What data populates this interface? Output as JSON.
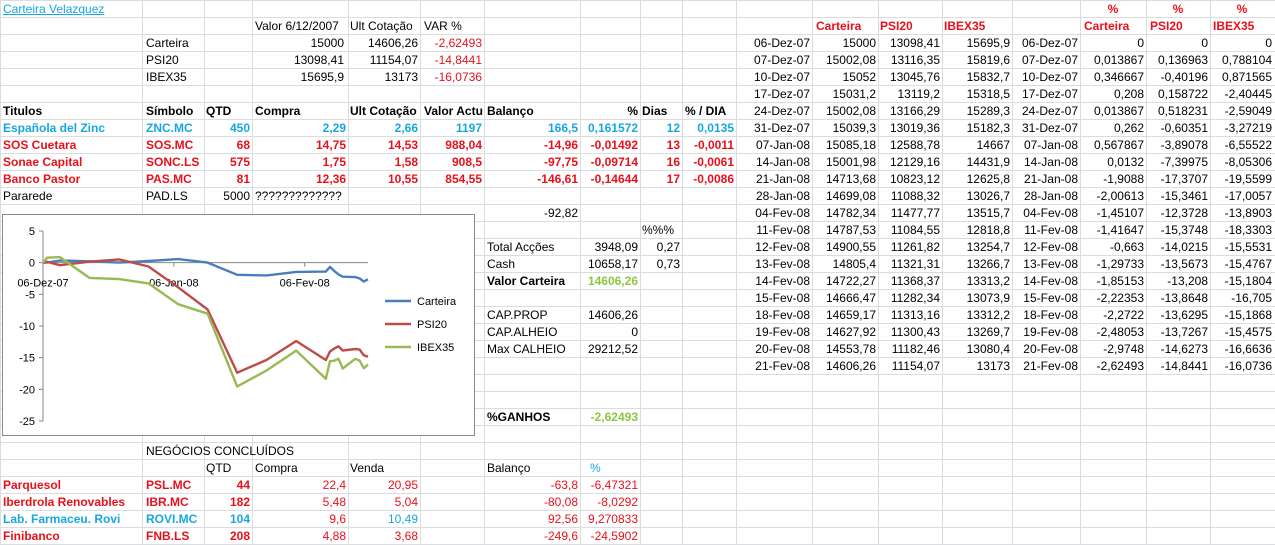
{
  "title": "Carteira Velazquez",
  "summary": {
    "headers": [
      "Valor 6/12/2007",
      "Ult Cotação",
      "VAR %"
    ],
    "rows": [
      {
        "label": "Carteira",
        "v1": "15000",
        "v2": "14606,26",
        "var": "-2,62493"
      },
      {
        "label": "PSI20",
        "v1": "13098,41",
        "v2": "11154,07",
        "var": "-14,8441"
      },
      {
        "label": "IBEX35",
        "v1": "15695,9",
        "v2": "13173",
        "var": "-16,0736"
      }
    ]
  },
  "holdings": {
    "headers": [
      "Titulos",
      "Símbolo",
      "QTD",
      "Compra",
      "Ult Cotação",
      "Valor Actu",
      "Balanço",
      "%",
      "Dias",
      "% / DIA"
    ],
    "rows": [
      {
        "name": "Española del Zinc",
        "sym": "ZNC.MC",
        "qtd": "450",
        "compra": "2,29",
        "ult": "2,66",
        "valor": "1197",
        "bal": "166,5",
        "pct": "0,161572",
        "dias": "12",
        "pdia": "0,0135",
        "color": "blue"
      },
      {
        "name": "SOS Cuetara",
        "sym": "SOS.MC",
        "qtd": "68",
        "compra": "14,75",
        "ult": "14,53",
        "valor": "988,04",
        "bal": "-14,96",
        "pct": "-0,01492",
        "dias": "13",
        "pdia": "-0,0011",
        "color": "red"
      },
      {
        "name": "Sonae Capital",
        "sym": "SONC.LS",
        "qtd": "575",
        "compra": "1,75",
        "ult": "1,58",
        "valor": "908,5",
        "bal": "-97,75",
        "pct": "-0,09714",
        "dias": "16",
        "pdia": "-0,0061",
        "color": "red"
      },
      {
        "name": "Banco Pastor",
        "sym": "PAS.MC",
        "qtd": "81",
        "compra": "12,36",
        "ult": "10,55",
        "valor": "854,55",
        "bal": "-146,61",
        "pct": "-0,14644",
        "dias": "17",
        "pdia": "-0,0086",
        "color": "red"
      },
      {
        "name": "Pararede",
        "sym": "PAD.LS",
        "qtd": "5000",
        "compra": "?????????????",
        "ult": "",
        "valor": "",
        "bal": "",
        "pct": "",
        "dias": "",
        "pdia": "",
        "color": "plain"
      }
    ],
    "total_balance": "-92,82"
  },
  "stats": {
    "pct_header": "%%%",
    "rows": [
      {
        "label": "Total Acções",
        "value": "3948,09",
        "pct": "0,27"
      },
      {
        "label": "Cash",
        "value": "10658,17",
        "pct": "0,73"
      }
    ],
    "valor_carteira_label": "Valor Carteira",
    "valor_carteira": "14606,26",
    "cap_rows": [
      {
        "label": "CAP.PROP",
        "value": "14606,26"
      },
      {
        "label": "CAP.ALHEIO",
        "value": "0"
      },
      {
        "label": "Max CALHEIO",
        "value": "29212,52"
      }
    ],
    "ganhos_label": "%GANHOS",
    "ganhos": "-2,62493"
  },
  "closed": {
    "title": "NEGÓCIOS CONCLUÍDOS",
    "headers": {
      "qtd": "QTD",
      "compra": "Compra",
      "venda": "Venda",
      "bal": "Balanço",
      "pct": "%"
    },
    "rows": [
      {
        "name": "Parquesol",
        "sym": "PSL.MC",
        "qtd": "44",
        "compra": "22,4",
        "venda": "20,95",
        "bal": "-63,8",
        "pct": "-6,47321",
        "color": "red"
      },
      {
        "name": "Iberdrola Renovables",
        "sym": "IBR.MC",
        "qtd": "182",
        "compra": "5,48",
        "venda": "5,04",
        "bal": "-80,08",
        "pct": "-8,0292",
        "color": "red"
      },
      {
        "name": "Lab. Farmaceu. Rovi",
        "sym": "ROVI.MC",
        "qtd": "104",
        "compra": "9,6",
        "venda": "10,49",
        "bal": "92,56",
        "pct": "9,270833",
        "color": "blue"
      },
      {
        "name": "Finibanco",
        "sym": "FNB.LS",
        "qtd": "208",
        "compra": "4,88",
        "venda": "3,68",
        "bal": "-249,6",
        "pct": "-24,5902",
        "color": "red"
      }
    ]
  },
  "history": {
    "headers": [
      "Carteira",
      "PSI20",
      "IBEX35"
    ],
    "rows": [
      [
        "06-Dez-07",
        "15000",
        "13098,41",
        "15695,9"
      ],
      [
        "07-Dez-07",
        "15002,08",
        "13116,35",
        "15819,6"
      ],
      [
        "10-Dez-07",
        "15052",
        "13045,76",
        "15832,7"
      ],
      [
        "17-Dez-07",
        "15031,2",
        "13119,2",
        "15318,5"
      ],
      [
        "24-Dez-07",
        "15002,08",
        "13166,29",
        "15289,3"
      ],
      [
        "31-Dez-07",
        "15039,3",
        "13019,36",
        "15182,3"
      ],
      [
        "07-Jan-08",
        "15085,18",
        "12588,78",
        "14667"
      ],
      [
        "14-Jan-08",
        "15001,98",
        "12129,16",
        "14431,9"
      ],
      [
        "21-Jan-08",
        "14713,68",
        "10823,12",
        "12625,8"
      ],
      [
        "28-Jan-08",
        "14699,08",
        "11088,32",
        "13026,7"
      ],
      [
        "04-Fev-08",
        "14782,34",
        "11477,77",
        "13515,7"
      ],
      [
        "11-Fev-08",
        "14787,53",
        "11084,55",
        "12818,8"
      ],
      [
        "12-Fev-08",
        "14900,55",
        "11261,82",
        "13254,7"
      ],
      [
        "13-Fev-08",
        "14805,4",
        "11321,31",
        "13266,7"
      ],
      [
        "14-Fev-08",
        "14722,27",
        "11368,37",
        "13313,2"
      ],
      [
        "15-Fev-08",
        "14666,47",
        "11282,34",
        "13073,9"
      ],
      [
        "18-Fev-08",
        "14659,17",
        "11313,16",
        "13312,2"
      ],
      [
        "19-Fev-08",
        "14627,92",
        "11300,43",
        "13269,7"
      ],
      [
        "20-Fev-08",
        "14553,78",
        "11182,46",
        "13080,4"
      ],
      [
        "21-Fev-08",
        "14606,26",
        "11154,07",
        "13173"
      ]
    ]
  },
  "pct_history": {
    "headers": [
      "Carteira",
      "PSI20",
      "IBEX35"
    ],
    "pct_symbol": "%",
    "rows": [
      [
        "06-Dez-07",
        "0",
        "0",
        "0"
      ],
      [
        "07-Dez-07",
        "0,013867",
        "0,136963",
        "0,788104"
      ],
      [
        "10-Dez-07",
        "0,346667",
        "-0,40196",
        "0,871565"
      ],
      [
        "17-Dez-07",
        "0,208",
        "0,158722",
        "-2,40445"
      ],
      [
        "24-Dez-07",
        "0,013867",
        "0,518231",
        "-2,59049"
      ],
      [
        "31-Dez-07",
        "0,262",
        "-0,60351",
        "-3,27219"
      ],
      [
        "07-Jan-08",
        "0,567867",
        "-3,89078",
        "-6,55522"
      ],
      [
        "14-Jan-08",
        "0,0132",
        "-7,39975",
        "-8,05306"
      ],
      [
        "21-Jan-08",
        "-1,9088",
        "-17,3707",
        "-19,5599"
      ],
      [
        "28-Jan-08",
        "-2,00613",
        "-15,3461",
        "-17,0057"
      ],
      [
        "04-Fev-08",
        "-1,45107",
        "-12,3728",
        "-13,8903"
      ],
      [
        "11-Fev-08",
        "-1,41647",
        "-15,3748",
        "-18,3303"
      ],
      [
        "12-Fev-08",
        "-0,663",
        "-14,0215",
        "-15,5531"
      ],
      [
        "13-Fev-08",
        "-1,29733",
        "-13,5673",
        "-15,4767"
      ],
      [
        "14-Fev-08",
        "-1,85153",
        "-13,208",
        "-15,1804"
      ],
      [
        "15-Fev-08",
        "-2,22353",
        "-13,8648",
        "-16,705"
      ],
      [
        "18-Fev-08",
        "-2,2722",
        "-13,6295",
        "-15,1868"
      ],
      [
        "19-Fev-08",
        "-2,48053",
        "-13,7267",
        "-15,4575"
      ],
      [
        "20-Fev-08",
        "-2,9748",
        "-14,6273",
        "-16,6636"
      ],
      [
        "21-Fev-08",
        "-2,62493",
        "-14,8441",
        "-16,0736"
      ]
    ]
  },
  "chart_data": {
    "type": "line",
    "x": [
      "06-Dez-07",
      "07-Dez-07",
      "10-Dez-07",
      "17-Dez-07",
      "24-Dez-07",
      "31-Dez-07",
      "07-Jan-08",
      "14-Jan-08",
      "21-Jan-08",
      "28-Jan-08",
      "04-Fev-08",
      "11-Fev-08",
      "12-Fev-08",
      "13-Fev-08",
      "14-Fev-08",
      "15-Fev-08",
      "18-Fev-08",
      "19-Fev-08",
      "20-Fev-08",
      "21-Fev-08"
    ],
    "x_ticks": [
      "06-Dez-07",
      "06-Jan-08",
      "06-Fev-08"
    ],
    "ylim": [
      -25,
      5
    ],
    "y_ticks": [
      "5",
      "0",
      "-5",
      "-10",
      "-15",
      "-20",
      "-25"
    ],
    "series": [
      {
        "name": "Carteira",
        "color": "#4a7ebb",
        "values": [
          0,
          0.013867,
          0.346667,
          0.208,
          0.013867,
          0.262,
          0.567867,
          0.0132,
          -1.9088,
          -2.00613,
          -1.45107,
          -1.41647,
          -0.663,
          -1.29733,
          -1.85153,
          -2.22353,
          -2.2722,
          -2.48053,
          -2.9748,
          -2.62493
        ]
      },
      {
        "name": "PSI20",
        "color": "#be4b48",
        "values": [
          0,
          0.136963,
          -0.40196,
          0.158722,
          0.518231,
          -0.60351,
          -3.89078,
          -7.39975,
          -17.3707,
          -15.3461,
          -12.3728,
          -15.3748,
          -14.0215,
          -13.5673,
          -13.208,
          -13.8648,
          -13.6295,
          -13.7267,
          -14.6273,
          -14.8441
        ]
      },
      {
        "name": "IBEX35",
        "color": "#98b954",
        "values": [
          0,
          0.788104,
          0.871565,
          -2.40445,
          -2.59049,
          -3.27219,
          -6.55522,
          -8.05306,
          -19.5599,
          -17.0057,
          -13.8903,
          -18.3303,
          -15.5531,
          -15.4767,
          -15.1804,
          -16.705,
          -15.1868,
          -15.4575,
          -16.6636,
          -16.0736
        ]
      }
    ],
    "legend": "right",
    "grid": false
  }
}
